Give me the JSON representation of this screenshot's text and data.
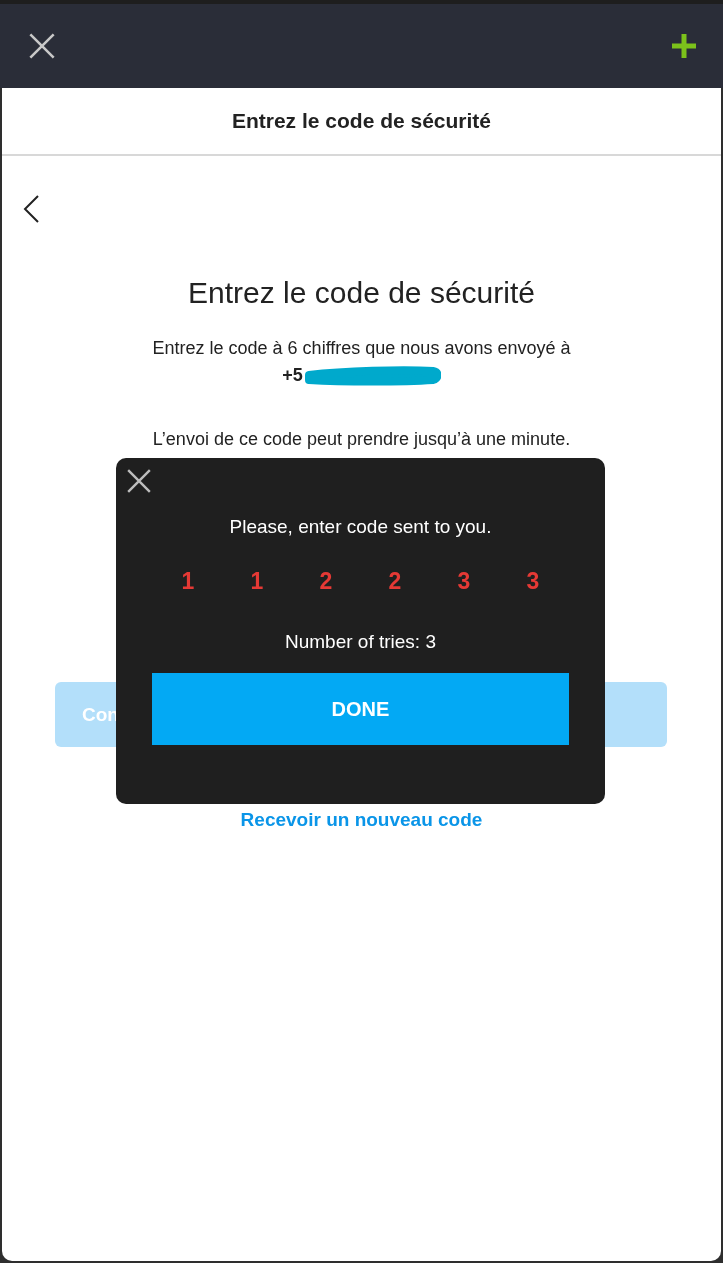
{
  "header": {
    "title": "Entrez le code de sécurité"
  },
  "page": {
    "title": "Entrez le code de sécurité",
    "instruction": "Entrez le code à 6 chiffres que nous avons envoyé à",
    "phone_prefix": "+5",
    "phone_redacted": true,
    "note": "L’envoi de ce code peut prendre jusqu’à une minute.",
    "continue_button": {
      "label": "Con",
      "disabled": true
    },
    "resend_link": "Recevoir un nouveau code"
  },
  "dialog": {
    "message": "Please, enter code sent to you.",
    "code_digits": [
      "1",
      "1",
      "2",
      "2",
      "3",
      "3"
    ],
    "tries": "Number of tries: 3",
    "done_button": "DONE"
  }
}
